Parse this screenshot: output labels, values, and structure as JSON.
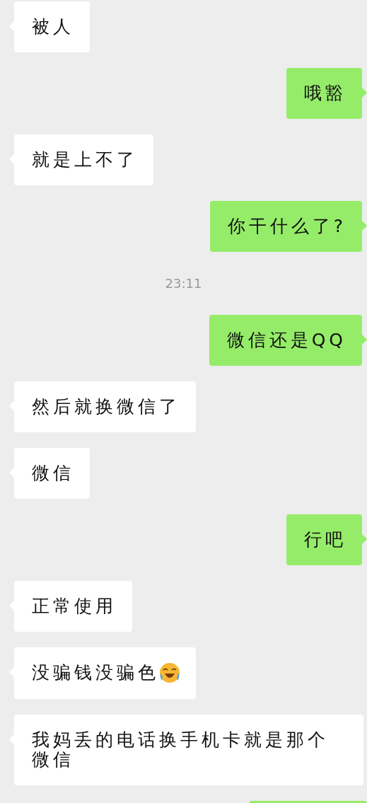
{
  "messages": [
    {
      "kind": "text",
      "sent": false,
      "text": "被人"
    },
    {
      "kind": "text",
      "sent": true,
      "text": "哦豁"
    },
    {
      "kind": "text",
      "sent": false,
      "text": "就是上不了"
    },
    {
      "kind": "text",
      "sent": true,
      "text": "你干什么了?"
    },
    {
      "kind": "time",
      "text": "23:11"
    },
    {
      "kind": "text",
      "sent": true,
      "text": "微信还是QQ"
    },
    {
      "kind": "text",
      "sent": false,
      "text": "然后就换微信了"
    },
    {
      "kind": "text",
      "sent": false,
      "text": "微信"
    },
    {
      "kind": "text",
      "sent": true,
      "text": "行吧"
    },
    {
      "kind": "text",
      "sent": false,
      "text": "正常使用"
    },
    {
      "kind": "text_emoji",
      "sent": false,
      "text": "没骗钱没骗色"
    },
    {
      "kind": "text",
      "sent": false,
      "text": "我妈丢的电话换手机卡就是那个微信"
    },
    {
      "kind": "cut",
      "sent": true
    }
  ]
}
